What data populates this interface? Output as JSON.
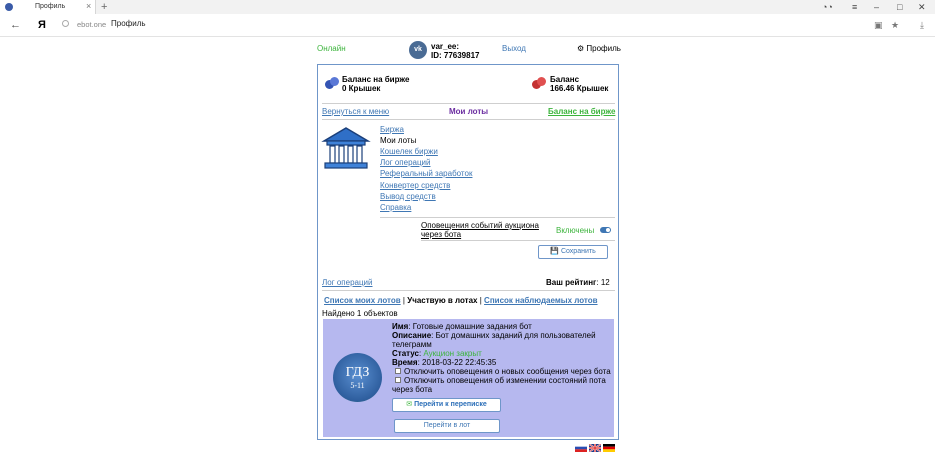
{
  "browser": {
    "tab_title": "Профиль",
    "url_domain": "ebot.one",
    "url_title": "Профиль"
  },
  "header": {
    "status": "Онлайн",
    "vk_logo": "vk",
    "user_name": "var_ee:",
    "user_id": "ID: 77639817",
    "logout": "Выход",
    "profile": "Профиль"
  },
  "balance": {
    "exchange_title": "Баланс на бирже",
    "exchange_value": "0 Крышек",
    "main_title": "Баланс",
    "main_value": "166.46 Крышек"
  },
  "nav": {
    "back": "Вернуться к меню",
    "my_lots": "Мои лоты",
    "exchange_balance": "Баланс на бирже"
  },
  "menu": {
    "items": [
      "Биржа",
      "Мои лоты",
      "Кошелек биржи",
      "Лог операций",
      "Реферальный заработок",
      "Конвертер средств",
      "Вывод средств",
      "Справка"
    ]
  },
  "notifications": {
    "label_line1": "Оповещения событий аукциона",
    "label_line2": "через бота",
    "state": "Включены",
    "save": "Сохранить"
  },
  "footer_row": {
    "log": "Лог операций",
    "rating_label": "Ваш рейтинг",
    "rating_value": "12"
  },
  "lists": {
    "my_lots": "Список моих лотов",
    "sep": "|",
    "participating": "Участвую в лотах",
    "watched": "Список наблюдаемых лотов",
    "found": "Найдено 1 объектов"
  },
  "lot": {
    "avatar_line1": "ГДЗ",
    "avatar_line2": "5-11",
    "name_label": "Имя",
    "name_value": ": Готовые домашние задания бот",
    "desc_label": "Описание",
    "desc_value": ": Бот домашних заданий для пользователей",
    "desc_value2": "телеграмм",
    "status_label": "Статус",
    "status_value": "Аукцион закрыт",
    "time_label": "Время",
    "time_value": ": 2018-03-22 22:45:35",
    "opt1": "Отключить оповещения о новых сообщения через бота",
    "opt2_line1": "Отключить оповещения об изменении состояний пота",
    "opt2_line2": "через бота",
    "chat_button": "Перейти к переписке",
    "lot_button": "Перейти в лот"
  },
  "colors": {
    "link": "#3f77b4",
    "online": "#3cb43c",
    "active_tab": "#6a2ca0",
    "exchange_link": "#3cb43c",
    "lot_card": "#b6b8ef",
    "status_closed": "#3cb43c"
  }
}
